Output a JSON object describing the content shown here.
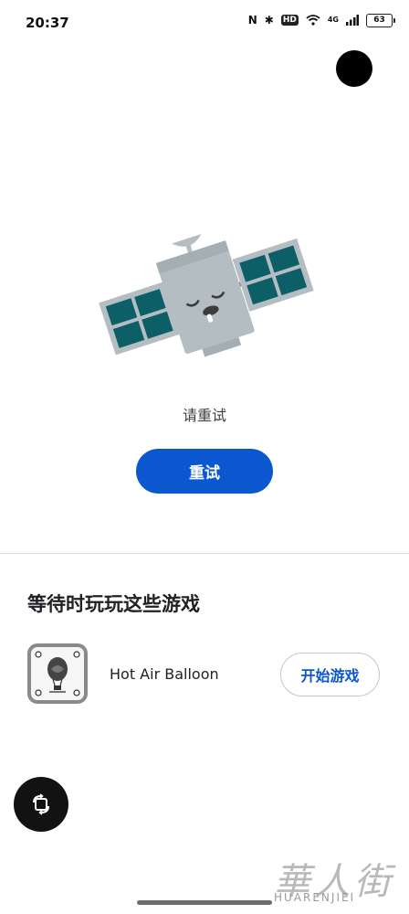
{
  "status_bar": {
    "time": "20:37",
    "nfc": "N",
    "bluetooth": "✱",
    "hd": "HD",
    "network": "4G",
    "battery": "63"
  },
  "error": {
    "message": "请重试",
    "retry_label": "重试"
  },
  "games": {
    "heading": "等待时玩玩这些游戏",
    "items": [
      {
        "title": "Hot Air Balloon",
        "play_label": "开始游戏"
      }
    ]
  },
  "watermark": {
    "script": "華人街",
    "latin": "HUARENJIEI"
  },
  "colors": {
    "accent": "#0b57d0",
    "panel": "#0c5f66",
    "satellite_body": "#b4bec2"
  }
}
